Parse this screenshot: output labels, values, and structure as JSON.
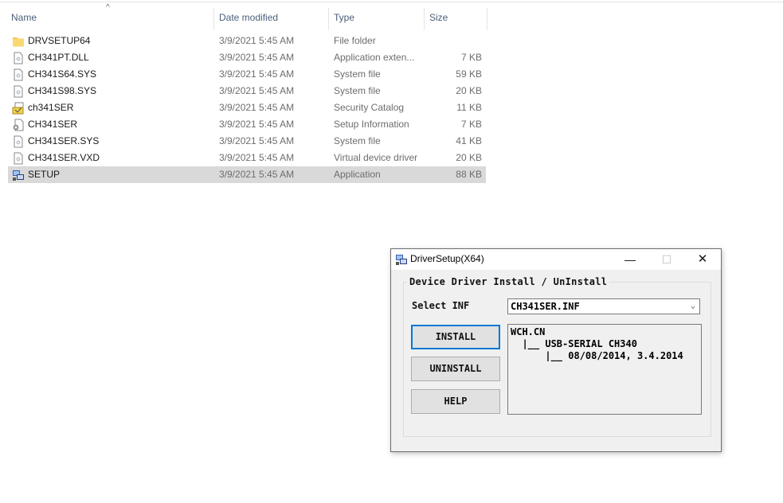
{
  "explorer": {
    "columns": [
      {
        "label": "Name"
      },
      {
        "label": "Date modified"
      },
      {
        "label": "Type"
      },
      {
        "label": "Size"
      }
    ],
    "sort_indicator": "^",
    "files": [
      {
        "name": "DRVSETUP64",
        "date": "3/9/2021 5:45 AM",
        "type": "File folder",
        "size": "",
        "icon": "folder-icon"
      },
      {
        "name": "CH341PT.DLL",
        "date": "3/9/2021 5:45 AM",
        "type": "Application exten...",
        "size": "7 KB",
        "icon": "dll-file-icon"
      },
      {
        "name": "CH341S64.SYS",
        "date": "3/9/2021 5:45 AM",
        "type": "System file",
        "size": "59 KB",
        "icon": "system-file-icon"
      },
      {
        "name": "CH341S98.SYS",
        "date": "3/9/2021 5:45 AM",
        "type": "System file",
        "size": "20 KB",
        "icon": "system-file-icon"
      },
      {
        "name": "ch341SER",
        "date": "3/9/2021 5:45 AM",
        "type": "Security Catalog",
        "size": "11 KB",
        "icon": "security-catalog-icon"
      },
      {
        "name": "CH341SER",
        "date": "3/9/2021 5:45 AM",
        "type": "Setup Information",
        "size": "7 KB",
        "icon": "setup-info-icon"
      },
      {
        "name": "CH341SER.SYS",
        "date": "3/9/2021 5:45 AM",
        "type": "System file",
        "size": "41 KB",
        "icon": "system-file-icon"
      },
      {
        "name": "CH341SER.VXD",
        "date": "3/9/2021 5:45 AM",
        "type": "Virtual device driver",
        "size": "20 KB",
        "icon": "system-file-icon"
      },
      {
        "name": "SETUP",
        "date": "3/9/2021 5:45 AM",
        "type": "Application",
        "size": "88 KB",
        "icon": "setup-app-icon",
        "selected": true
      }
    ]
  },
  "dialog": {
    "title": "DriverSetup(X64)",
    "minimize_glyph": "—",
    "maximize_glyph": "☐",
    "close_glyph": "✕",
    "group_label": "Device Driver Install / UnInstall",
    "select_label": "Select INF",
    "select_value": "CH341SER.INF",
    "buttons": {
      "install": "INSTALL",
      "uninstall": "UNINSTALL",
      "help": "HELP"
    },
    "info_lines": [
      "WCH.CN",
      "  |__ USB-SERIAL CH340",
      "      |__ 08/08/2014, 3.4.2014"
    ]
  },
  "colors": {
    "header_text": "#4c607a",
    "selected_row": "#d9d9d9",
    "default_button_border": "#0078d7",
    "dialog_bg": "#f0f0f0"
  }
}
